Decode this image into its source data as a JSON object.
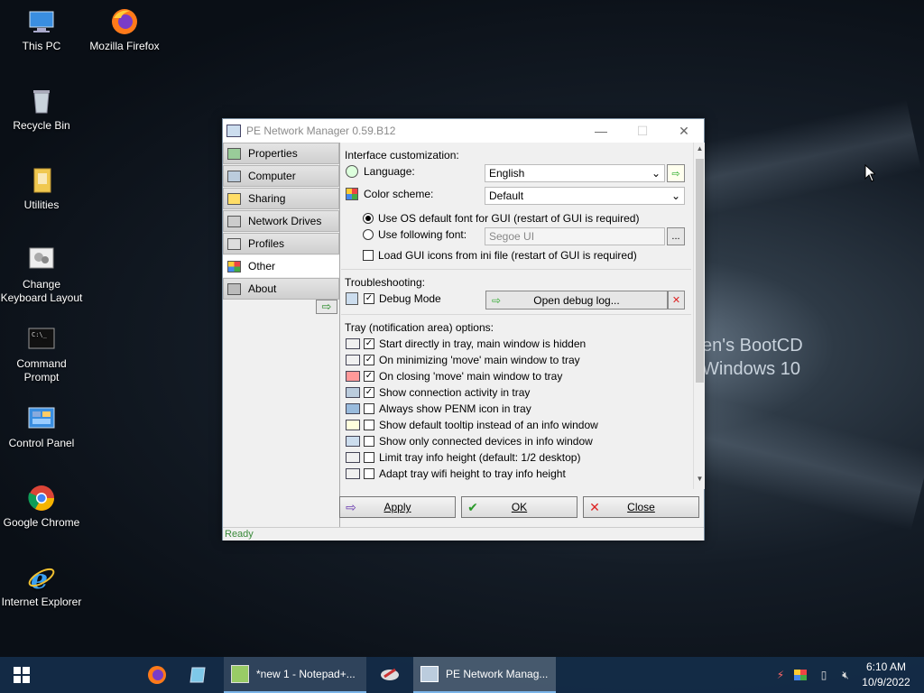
{
  "desktop": {
    "icons": [
      {
        "label": "This PC"
      },
      {
        "label": "Mozilla Firefox"
      },
      {
        "label": "Recycle Bin"
      },
      {
        "label": "Utilities"
      },
      {
        "label": "Change Keyboard Layout"
      },
      {
        "label": "Command Prompt"
      },
      {
        "label": "Control Panel"
      },
      {
        "label": "Google Chrome"
      },
      {
        "label": "Internet Explorer"
      }
    ],
    "wallpaper_text": [
      "en's BootCD",
      "Windows 10"
    ]
  },
  "window": {
    "title": "PE Network Manager 0.59.B12",
    "controls": {
      "minimize": "—",
      "maximize": "☐",
      "close": "✕"
    },
    "sidebar": [
      {
        "label": "Properties",
        "icon": "properties-icon",
        "active": false
      },
      {
        "label": "Computer",
        "icon": "computer-icon",
        "active": false
      },
      {
        "label": "Sharing",
        "icon": "sharing-icon",
        "active": false
      },
      {
        "label": "Network Drives",
        "icon": "network-drives-icon",
        "active": false
      },
      {
        "label": "Profiles",
        "icon": "profiles-icon",
        "active": false
      },
      {
        "label": "Other",
        "icon": "other-icon",
        "active": true
      },
      {
        "label": "About",
        "icon": "about-icon",
        "active": false
      }
    ],
    "interface": {
      "heading": "Interface customization:",
      "language_label": "Language:",
      "language_value": "English",
      "color_scheme_label": "Color scheme:",
      "color_scheme_value": "Default",
      "font_os_default": "Use OS default font for GUI (restart of GUI is required)",
      "font_following": "Use following font:",
      "font_value": "Segoe UI",
      "font_browse": "...",
      "load_icons": "Load GUI icons from ini file (restart of GUI is required)"
    },
    "troubleshooting": {
      "heading": "Troubleshooting:",
      "debug_mode": "Debug Mode",
      "open_debug_log": "Open debug log..."
    },
    "tray": {
      "heading": "Tray (notification area) options:",
      "options": [
        {
          "label": "Start directly in tray, main window is hidden",
          "checked": true
        },
        {
          "label": "On minimizing 'move' main window to tray",
          "checked": true
        },
        {
          "label": "On closing 'move' main window to tray",
          "checked": true
        },
        {
          "label": "Show connection activity in tray",
          "checked": true
        },
        {
          "label": "Always show PENM icon in tray",
          "checked": false
        },
        {
          "label": "Show default tooltip instead of an info window",
          "checked": false
        },
        {
          "label": "Show only connected devices in info window",
          "checked": false
        },
        {
          "label": "Limit tray info height (default: 1/2 desktop)",
          "checked": false
        },
        {
          "label": "Adapt tray wifi height to tray info height",
          "checked": false
        }
      ]
    },
    "buttons": {
      "apply": "Apply",
      "ok": "OK",
      "close": "Close"
    },
    "status": "Ready"
  },
  "taskbar": {
    "notepad": "*new 1 - Notepad+...",
    "penm": "PE Network Manag...",
    "time": "6:10 AM",
    "date": "10/9/2022"
  },
  "colors": {
    "taskbar": "#142c48",
    "status_text": "#3a8a3a",
    "accent": "#7ab4e8"
  }
}
